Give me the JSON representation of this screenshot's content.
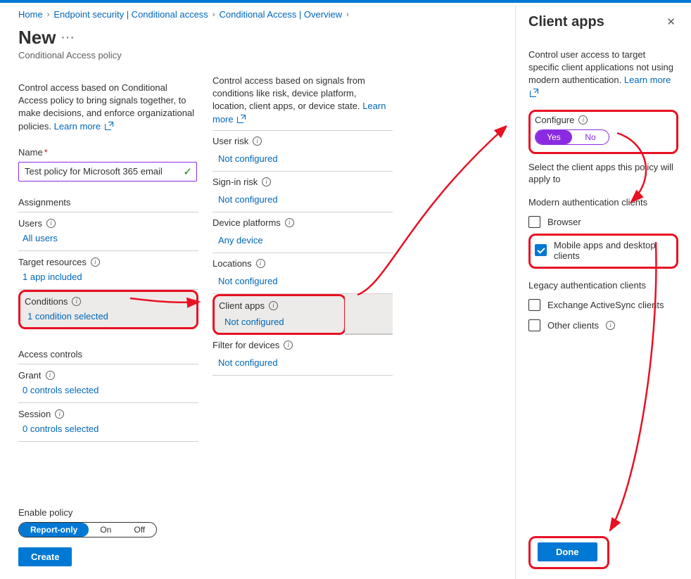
{
  "breadcrumb": {
    "home": "Home",
    "b1": "Endpoint security | Conditional access",
    "b2": "Conditional Access | Overview"
  },
  "page": {
    "title": "New",
    "subtitle": "Conditional Access policy"
  },
  "col1": {
    "intro": "Control access based on Conditional Access policy to bring signals together, to make decisions, and enforce organizational policies.",
    "learn_more": "Learn more",
    "name_label": "Name",
    "name_value": "Test policy for Microsoft 365 email",
    "assignments_header": "Assignments",
    "users": {
      "label": "Users",
      "value": "All users"
    },
    "targets": {
      "label": "Target resources",
      "value": "1 app included"
    },
    "conditions": {
      "label": "Conditions",
      "value": "1 condition selected"
    },
    "access_header": "Access controls",
    "grant": {
      "label": "Grant",
      "value": "0 controls selected"
    },
    "session": {
      "label": "Session",
      "value": "0 controls selected"
    }
  },
  "col2": {
    "intro": "Control access based on signals from conditions like risk, device platform, location, client apps, or device state.",
    "learn_more": "Learn more",
    "user_risk": {
      "label": "User risk",
      "value": "Not configured"
    },
    "signin_risk": {
      "label": "Sign-in risk",
      "value": "Not configured"
    },
    "device_plat": {
      "label": "Device platforms",
      "value": "Any device"
    },
    "locations": {
      "label": "Locations",
      "value": "Not configured"
    },
    "client_apps": {
      "label": "Client apps",
      "value": "Not configured"
    },
    "filter_dev": {
      "label": "Filter for devices",
      "value": "Not configured"
    }
  },
  "bottom": {
    "enable_label": "Enable policy",
    "opt_report": "Report-only",
    "opt_on": "On",
    "opt_off": "Off",
    "create": "Create"
  },
  "pane": {
    "title": "Client apps",
    "desc": "Control user access to target specific client applications not using modern authentication.",
    "learn_more": "Learn more",
    "configure_label": "Configure",
    "toggle_yes": "Yes",
    "toggle_no": "No",
    "select_desc": "Select the client apps this policy will apply to",
    "cat_modern": "Modern authentication clients",
    "cb_browser": "Browser",
    "cb_mobile": "Mobile apps and desktop clients",
    "cat_legacy": "Legacy authentication clients",
    "cb_eas": "Exchange ActiveSync clients",
    "cb_other": "Other clients",
    "done": "Done"
  }
}
